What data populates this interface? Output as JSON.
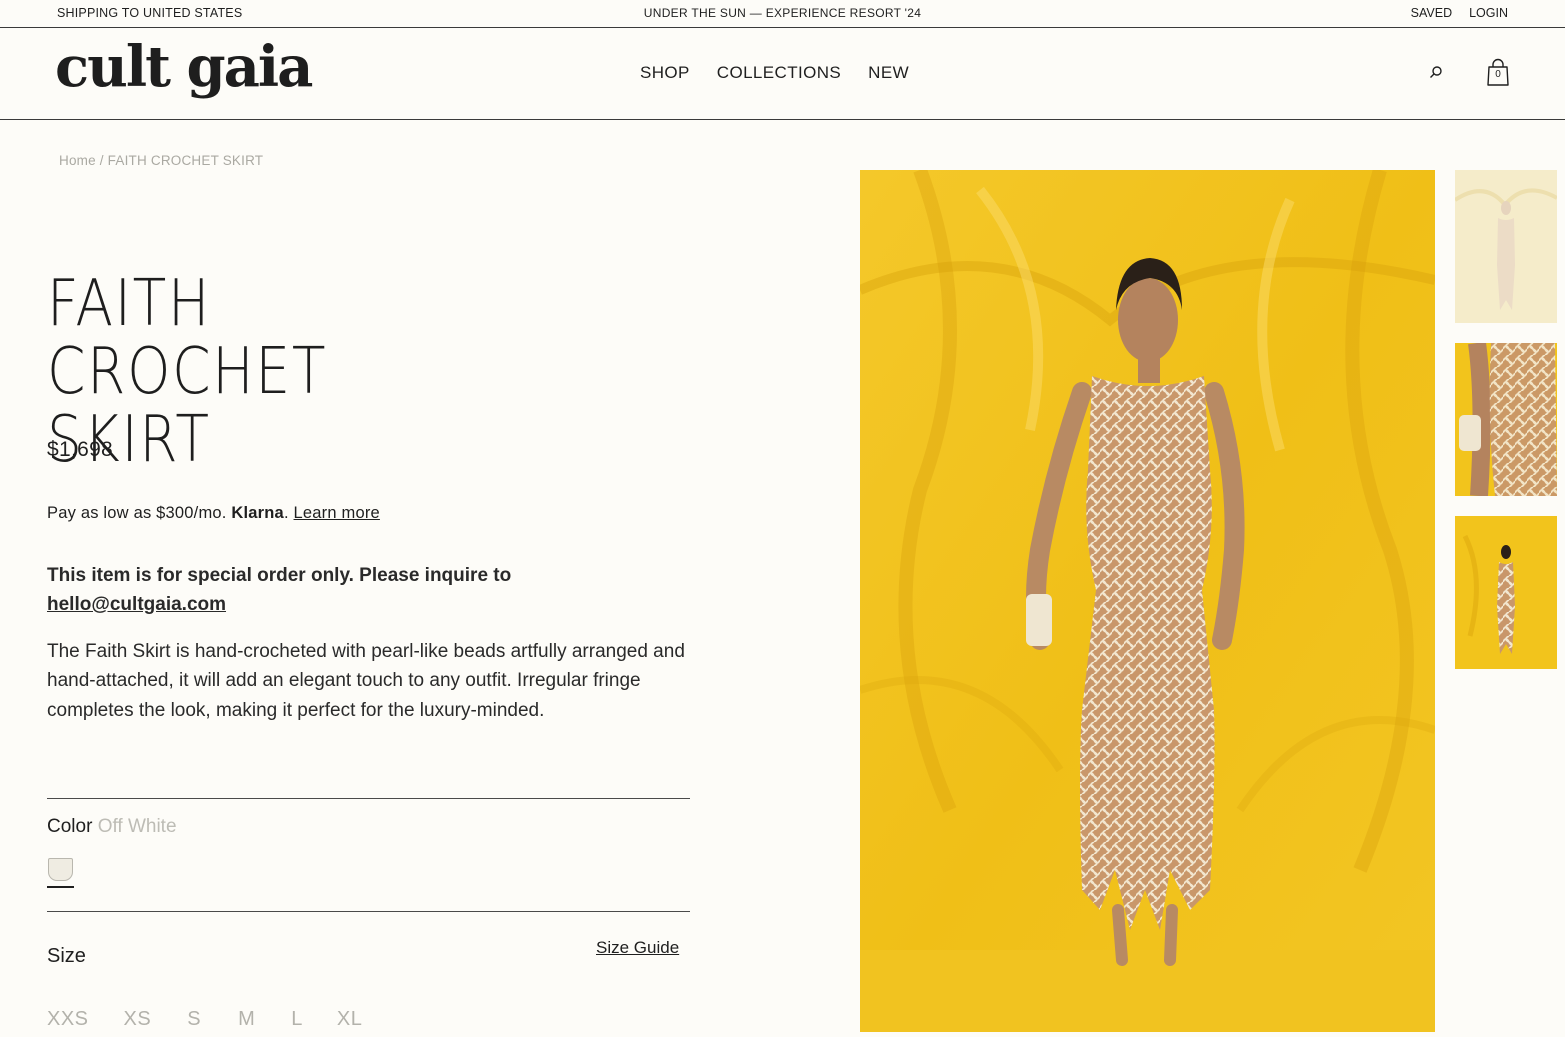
{
  "announcement": {
    "left": "SHIPPING TO UNITED STATES",
    "center": "UNDER THE SUN — EXPERIENCE RESORT '24",
    "saved": "SAVED",
    "login": "LOGIN"
  },
  "header": {
    "logo": "cult gaia",
    "nav": [
      "SHOP",
      "COLLECTIONS",
      "NEW"
    ],
    "search_icon": "search-icon",
    "bag_icon": "shopping-bag-icon",
    "bag_count": "0"
  },
  "breadcrumb": {
    "home": "Home",
    "separator": "/",
    "current": "FAITH CROCHET SKIRT"
  },
  "product": {
    "title": "FAITH CROCHET SKIRT",
    "price": "$1,698",
    "klarna_prefix": "Pay as low as $300/mo.",
    "klarna_brand": "Klarna",
    "klarna_dot": ".",
    "klarna_link": "Learn more",
    "special_order_text": "This item is for special order only. Please inquire to",
    "special_order_email": "hello@cultgaia.com",
    "description": "The Faith Skirt is hand-crocheted with pearl-like beads artfully arranged and hand-attached, it will add an elegant touch to any outfit. Irregular fringe completes the look, making it perfect for the luxury-minded.",
    "color_label": "Color",
    "color_value": "Off White",
    "swatch_color": "#efece2",
    "size_label": "Size",
    "size_guide": "Size Guide",
    "sizes": [
      "XXS",
      "XS",
      "S",
      "M",
      "L",
      "XL"
    ]
  },
  "colors": {
    "background": "#fdfcf8",
    "text": "#1f1f1f",
    "muted": "#aaa9a2",
    "photo_yellow": "#f2c41c"
  }
}
